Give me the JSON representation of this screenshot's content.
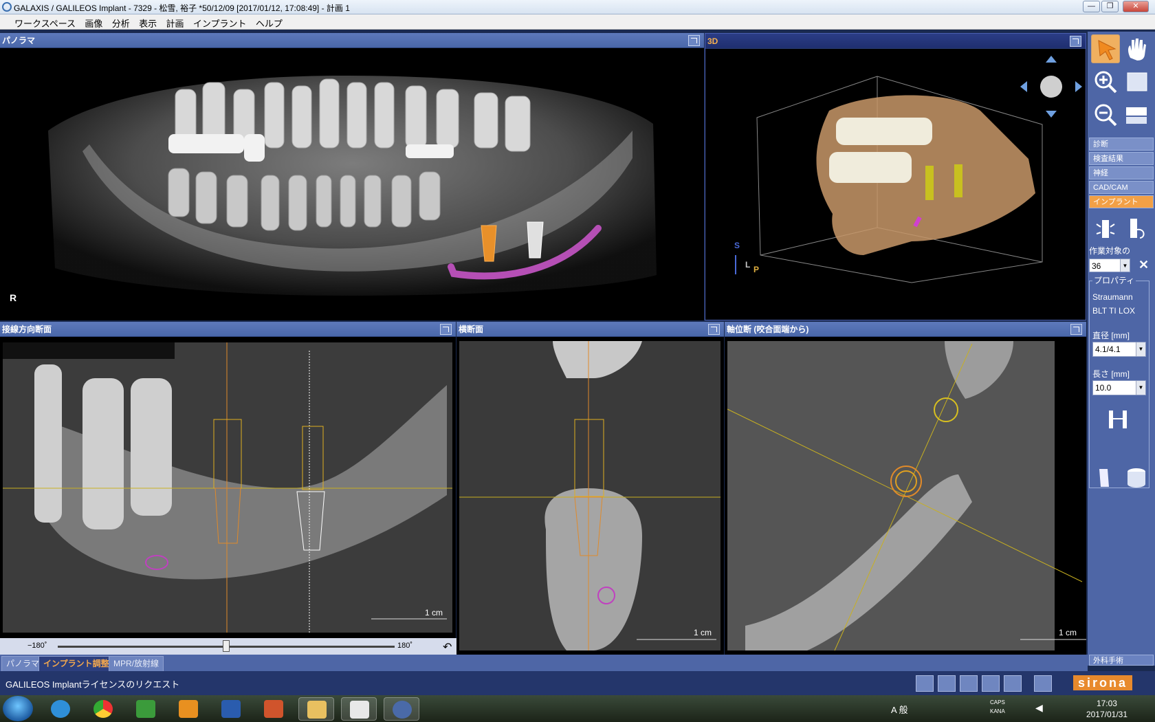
{
  "window": {
    "title": "GALAXIS / GALILEOS Implant - 7329 - 松雪, 裕子 *50/12/09 [2017/01/12, 17:08:49] - 計画 1",
    "minimize": "—",
    "maximize": "❐",
    "close": "✕"
  },
  "menu": [
    "ワークスペース",
    "画像",
    "分析",
    "表示",
    "計画",
    "インプラント",
    "ヘルプ"
  ],
  "panels": {
    "panorama": {
      "title": "パノラマ",
      "orientation": "R"
    },
    "view3d": {
      "title": "3D",
      "axis_s": "S",
      "axis_l": "L",
      "axis_p": "P"
    },
    "tangential": {
      "title": "接線方向断面",
      "scale": "1 cm"
    },
    "cross": {
      "title": "横断面",
      "scale": "1 cm"
    },
    "axial": {
      "title": "軸位断 (咬合面端から)",
      "scale": "1 cm"
    }
  },
  "slider": {
    "min_label": "−180˚",
    "max_label": "180˚",
    "value_fraction": 0.5
  },
  "right_panel": {
    "modes": [
      "診断",
      "検査結果",
      "神経",
      "CAD/CAM",
      "インプラント"
    ],
    "active_mode": "インプラント",
    "target_label": "作業対象の",
    "target_value": "36",
    "properties_label": "プロパティ",
    "brand": "Straumann",
    "model": "BLT TI LOX",
    "diameter_label": "直径 [mm]",
    "diameter_value": "4.1/4.1",
    "length_label": "長さ [mm]",
    "length_value": "10.0",
    "surgery_button": "外科手術"
  },
  "bottom_tabs": [
    "パノラマ",
    "インプラント調整",
    "MPR/放射線"
  ],
  "active_bottom_tab": "インプラント調整",
  "status": {
    "message": "GALILEOS Implantライセンスのリクエスト",
    "brand": "sirona"
  },
  "taskbar": {
    "ime": "A 般",
    "caps": "CAPS",
    "kana": "KANA",
    "time": "17:03",
    "date": "2017/01/31"
  },
  "colors": {
    "panel_header": "#4a67a9",
    "active_header": "#1f2f6f",
    "accent": "#f2a046",
    "nerve": "#c060c0",
    "implant_outline": "#e0a020"
  }
}
